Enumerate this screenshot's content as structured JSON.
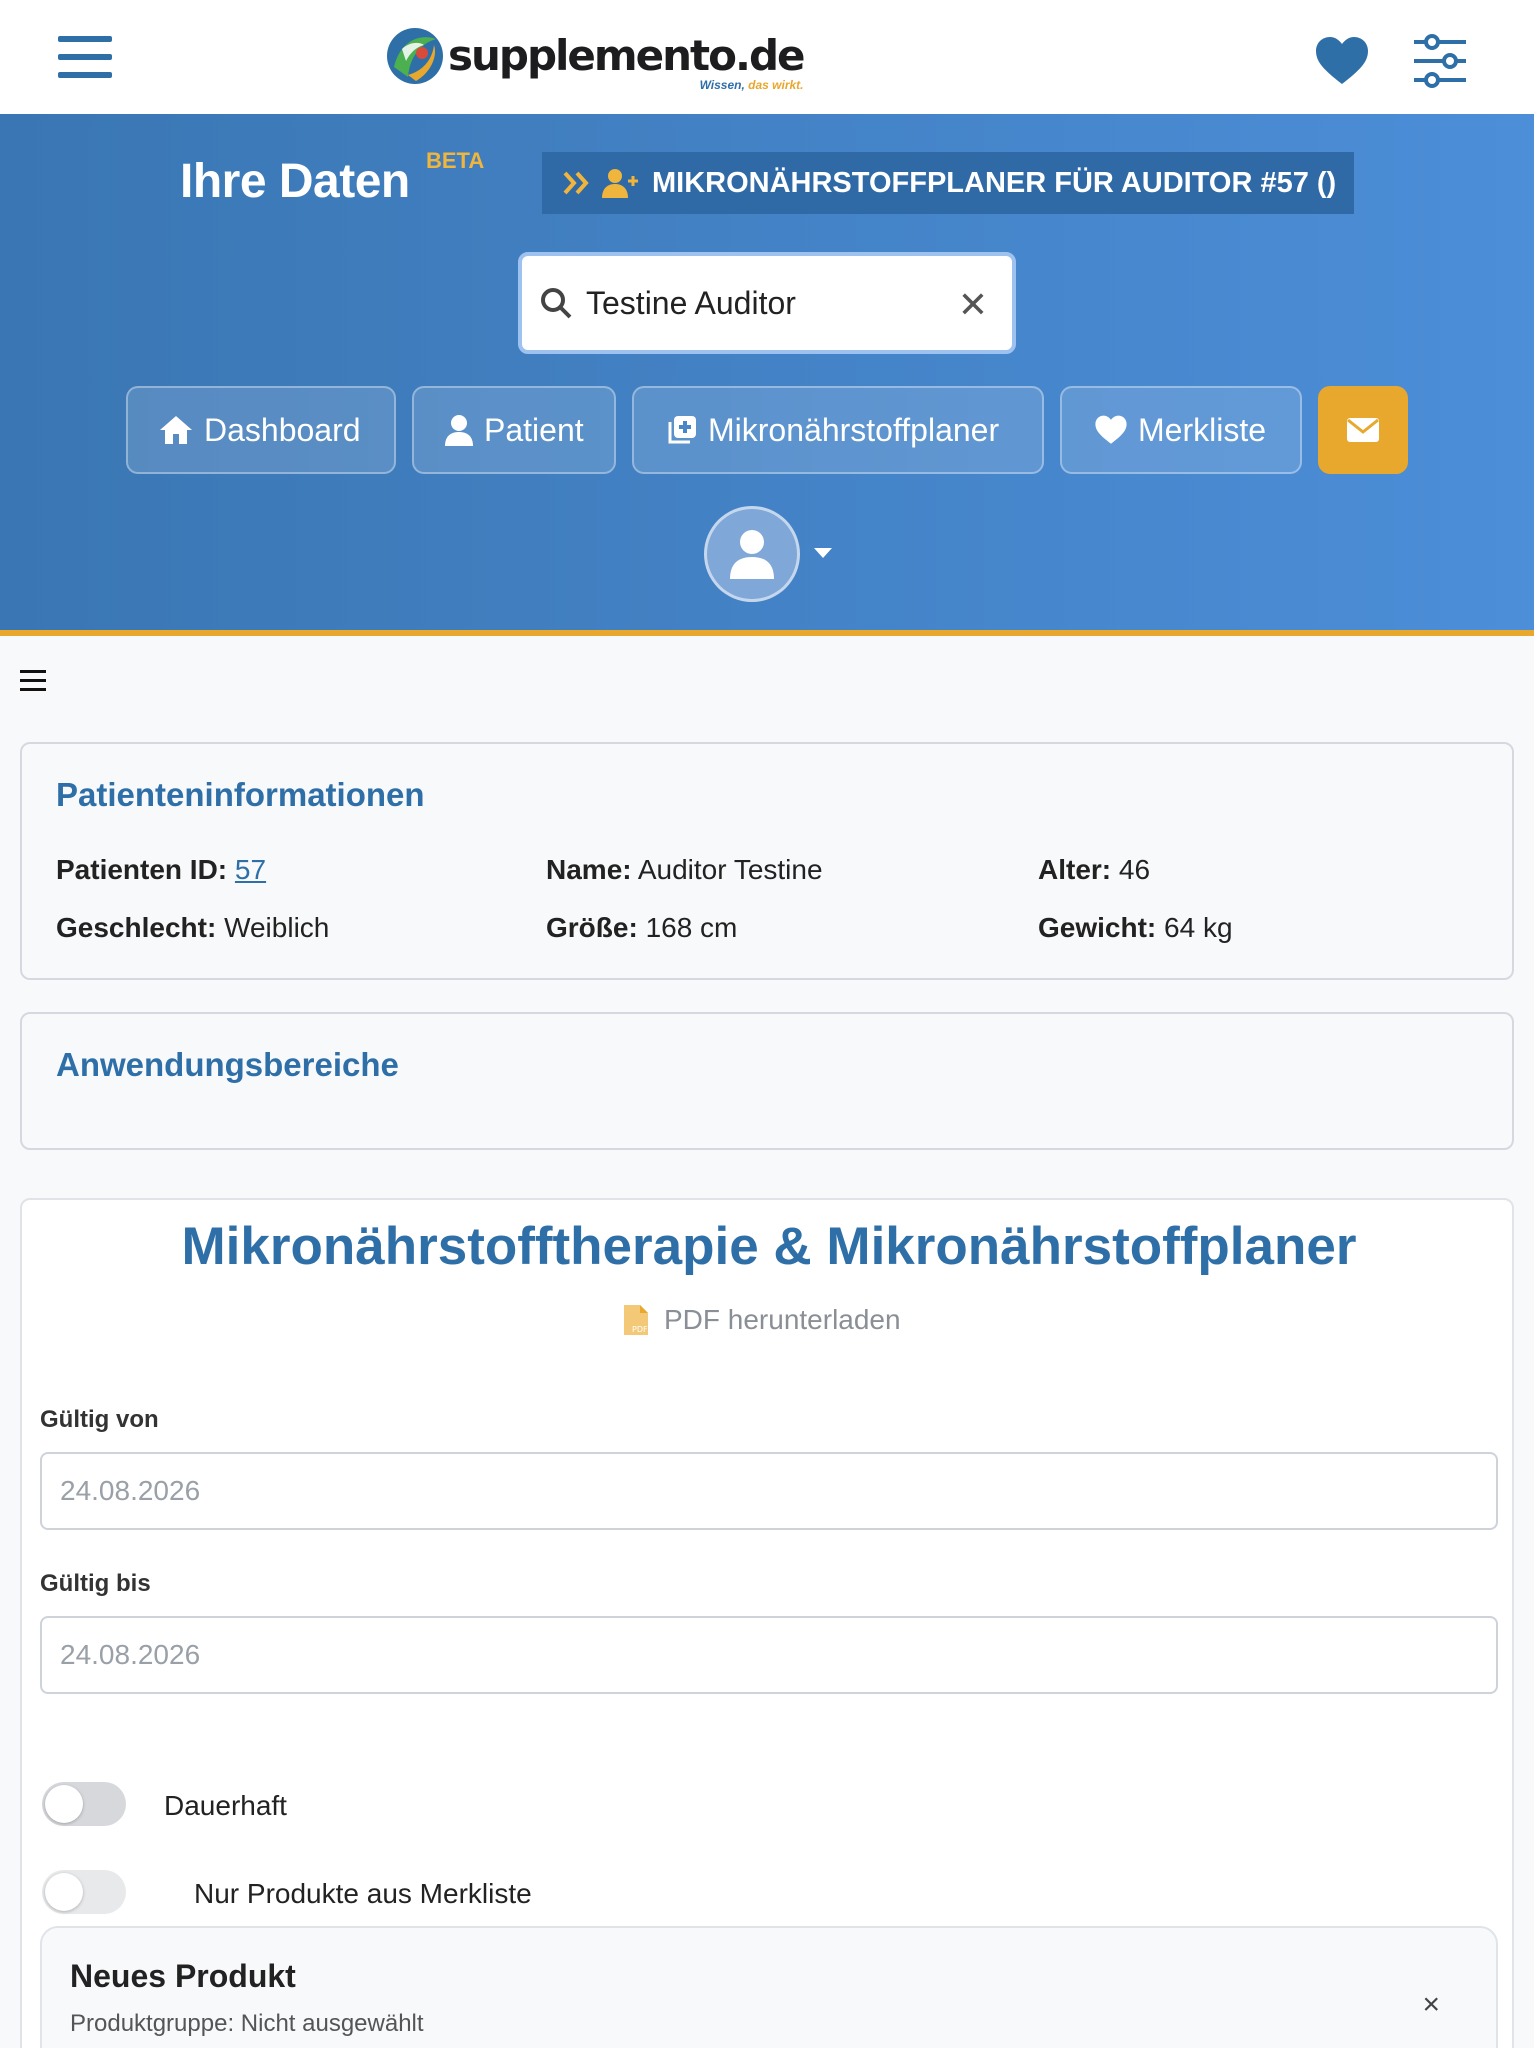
{
  "header": {
    "logo_name": "supplemento.de",
    "logo_tag_a": "Wissen, ",
    "logo_tag_b": "das wirkt."
  },
  "hero": {
    "title": "Ihre Daten",
    "beta": "BETA",
    "planner_label": "MIKRONÄHRSTOFFPLANER FÜR AUDITOR #57 ()",
    "search_value": "Testine Auditor",
    "search_clear": "✕",
    "nav": {
      "dashboard": "Dashboard",
      "patient": "Patient",
      "planner": "Mikronährstoffplaner",
      "merkliste": "Merkliste"
    }
  },
  "patient_info": {
    "title": "Patienteninformationen",
    "id_label": "Patienten ID:",
    "id_value": "57",
    "name_label": "Name:",
    "name_value": "Auditor Testine",
    "age_label": "Alter:",
    "age_value": "46",
    "gender_label": "Geschlecht:",
    "gender_value": "Weiblich",
    "height_label": "Größe:",
    "height_value": "168 cm",
    "weight_label": "Gewicht:",
    "weight_value": "64 kg"
  },
  "application": {
    "title": "Anwendungsbereiche"
  },
  "planner": {
    "title": "Mikronährstofftherapie & Mikronährstoffplaner",
    "pdf_label": "PDF herunterladen",
    "valid_from_label": "Gültig von",
    "valid_from_value": "24.08.2026",
    "valid_to_label": "Gültig bis",
    "valid_to_value": "24.08.2026",
    "permanent_label": "Dauerhaft",
    "merkliste_only_label": "Nur Produkte aus Merkliste",
    "new_product_title": "Neues Produkt",
    "new_product_group": "Produktgruppe: Nicht ausgewählt",
    "new_product_close": "×"
  },
  "colors": {
    "brand_blue": "#2f6fa8",
    "accent_orange": "#e8a72d"
  }
}
